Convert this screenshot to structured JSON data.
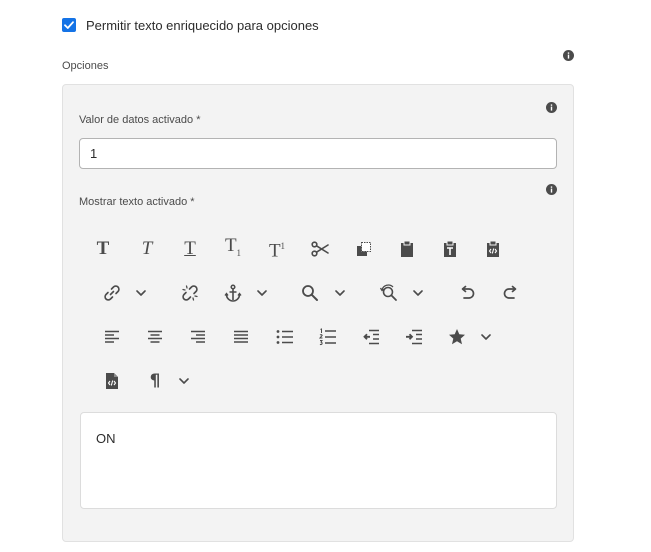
{
  "rich_text_checkbox": {
    "label": "Permitir texto enriquecido para opciones",
    "checked": true
  },
  "options_section": {
    "label": "Opciones"
  },
  "data_value_field": {
    "label": "Valor de datos activado *",
    "value": "1"
  },
  "display_text_field": {
    "label": "Mostrar texto activado *"
  },
  "editor": {
    "content": "ON"
  },
  "toolbar": {
    "bold_glyph": "T",
    "italic_glyph": "T",
    "underline_glyph": "T",
    "subscript_glyph": "T",
    "subscript_mark": "1",
    "superscript_glyph": "T",
    "superscript_mark": "1",
    "paragraph_glyph": "¶",
    "icons": [
      "bold-icon",
      "italic-icon",
      "underline-icon",
      "subscript-icon",
      "superscript-icon",
      "cut-icon",
      "copy-icon",
      "paste-icon",
      "paste-text-icon",
      "paste-html-icon",
      "link-icon",
      "unlink-icon",
      "anchor-icon",
      "find-icon",
      "find-replace-icon",
      "undo-icon",
      "redo-icon",
      "align-left-icon",
      "align-center-icon",
      "align-right-icon",
      "justify-icon",
      "bullet-list-icon",
      "numbered-list-icon",
      "outdent-icon",
      "indent-icon",
      "special-char-icon",
      "source-code-icon",
      "paragraph-format-icon"
    ]
  },
  "colors": {
    "accent": "#1473e6",
    "icon": "#4b4b4b",
    "panel_bg": "#f3f3f3"
  }
}
